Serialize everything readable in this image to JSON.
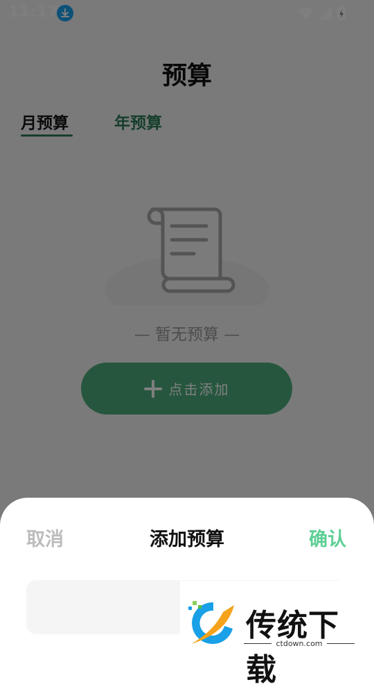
{
  "status_bar": {
    "time": "11:17",
    "icons": [
      "download-badge",
      "wifi-icon",
      "cell-signal-icon",
      "battery-charging-icon"
    ]
  },
  "header": {
    "title": "预算"
  },
  "tabs": [
    {
      "label": "月预算",
      "active": true
    },
    {
      "label": "年预算",
      "active": false
    }
  ],
  "empty_state": {
    "text": "— 暂无预算 —",
    "icon": "scroll-document-icon"
  },
  "add_button": {
    "label": "点击添加",
    "icon": "plus-icon"
  },
  "sheet": {
    "cancel_label": "取消",
    "title": "添加预算",
    "confirm_label": "确认",
    "input_value": ""
  },
  "watermark": {
    "name": "传统下载",
    "domain": "ctdown.com"
  },
  "colors": {
    "accent": "#2c7d58",
    "button": "#4caf7c",
    "confirm": "#5ecf95",
    "overlay": "rgba(0,0,0,0.5)"
  }
}
